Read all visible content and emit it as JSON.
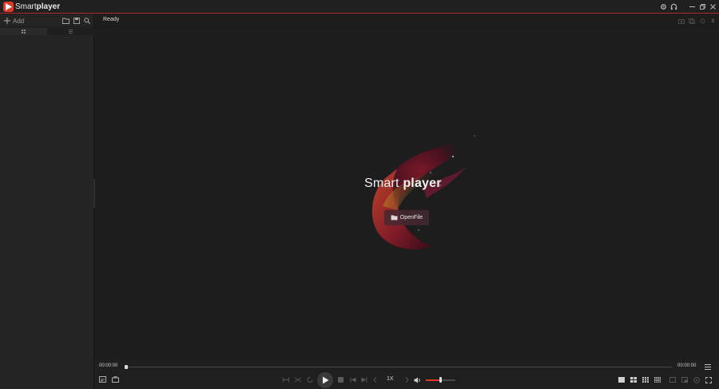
{
  "app": {
    "title_light": "Smart",
    "title_bold": "player",
    "accent_color": "#e03a27"
  },
  "titlebar": {
    "icons": [
      "gear-icon",
      "headset-icon",
      "minimize-icon",
      "restore-icon",
      "close-icon"
    ]
  },
  "sidebar": {
    "add_label": "Add",
    "toolbar_icons": [
      "add-folder-icon",
      "save-list-icon",
      "search-icon"
    ],
    "tabs": [
      "grid-icon",
      "list-icon"
    ]
  },
  "status": {
    "text": "Ready",
    "right_icons": [
      "camera-icon",
      "record-icon",
      "settings-icon",
      "pin-icon"
    ]
  },
  "splash": {
    "title_light": "Smart",
    "title_bold": "player",
    "open_button_label": "OpenFile"
  },
  "playback": {
    "current_time": "00:00:00",
    "total_time": "00:00:00",
    "speed": "1X",
    "volume": 0.5,
    "progress": 0
  }
}
